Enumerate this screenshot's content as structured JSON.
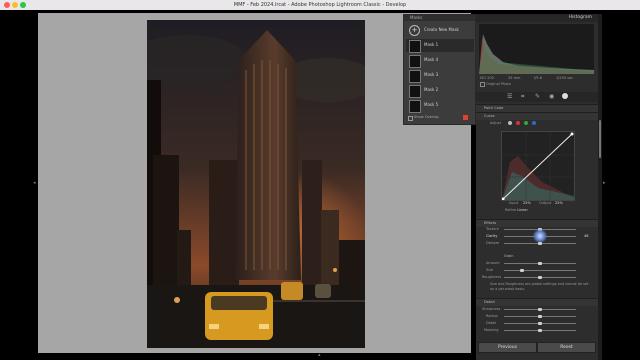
{
  "window": {
    "title": "MMF - Feb 2024.lrcat - Adobe Photoshop Lightroom Classic - Develop"
  },
  "masks_panel": {
    "title": "Masks",
    "create_label": "Create New Mask",
    "items": [
      "Mask 1",
      "Mask 4",
      "Mask 3",
      "Mask 2",
      "Mask 5"
    ],
    "show_overlay_label": "Show Overlay"
  },
  "histogram": {
    "title": "Histogram",
    "readout": [
      "ISO 200",
      "35 mm",
      "f/5.6",
      "1/250 sec"
    ],
    "original_photo_label": "Original Photo"
  },
  "sections": {
    "point_color": "Point Color",
    "curve": "Curve",
    "curve_adjust_label": "Adjust",
    "effects": "Effects",
    "detail": "Detail"
  },
  "curve_readout": {
    "input_label": "Input",
    "input_value": "25%",
    "output_label": "Output",
    "output_value": "25%",
    "refine_label": "Refine",
    "refine_value": "Linear"
  },
  "effects": {
    "sliders": [
      "Texture",
      "Clarity",
      "Dehaze"
    ],
    "clarity_value": "46",
    "grain_header": "Grain",
    "grain_sliders": [
      "Amount",
      "Size",
      "Roughness"
    ],
    "note": "Size and Roughness are global settings and cannot be set on a per-mask basis."
  },
  "detail_sliders": [
    "Sharpness",
    "Radius",
    "Detail",
    "Masking"
  ],
  "buttons": {
    "previous": "Previous",
    "reset": "Reset"
  }
}
